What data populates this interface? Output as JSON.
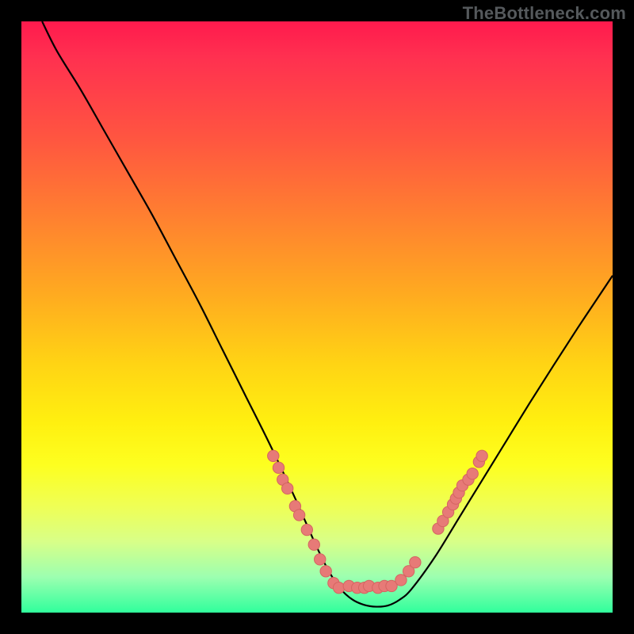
{
  "watermark": "TheBottleneck.com",
  "colors": {
    "curve_stroke": "#000000",
    "marker_fill": "#e77a77",
    "marker_stroke": "#d46561"
  },
  "chart_data": {
    "type": "line",
    "title": "",
    "xlabel": "",
    "ylabel": "",
    "xlim": [
      0,
      100
    ],
    "ylim": [
      0,
      100
    ],
    "curve": {
      "x": [
        3.5,
        6,
        10,
        14,
        18,
        22,
        26,
        30,
        34,
        38,
        42,
        46,
        48,
        50,
        52,
        54,
        56,
        58,
        60,
        62,
        64,
        66,
        70,
        74,
        78,
        82,
        86,
        90,
        94,
        98,
        100
      ],
      "y": [
        100,
        95,
        88.5,
        81.5,
        74.5,
        67.5,
        60,
        52.5,
        44.5,
        36.5,
        28.5,
        20,
        15.5,
        11,
        7,
        4,
        2.2,
        1.3,
        1.0,
        1.2,
        2.2,
        4,
        9.5,
        16,
        22.5,
        29,
        35.5,
        41.8,
        48,
        54,
        57
      ]
    },
    "markers": [
      {
        "x": 42.6,
        "y": 26.5
      },
      {
        "x": 43.5,
        "y": 24.5
      },
      {
        "x": 44.2,
        "y": 22.5
      },
      {
        "x": 45.0,
        "y": 21.0
      },
      {
        "x": 46.3,
        "y": 18.0
      },
      {
        "x": 47.0,
        "y": 16.5
      },
      {
        "x": 48.3,
        "y": 14.0
      },
      {
        "x": 49.5,
        "y": 11.5
      },
      {
        "x": 50.5,
        "y": 9.0
      },
      {
        "x": 51.5,
        "y": 7.0
      },
      {
        "x": 52.8,
        "y": 5.0
      },
      {
        "x": 53.7,
        "y": 4.2
      },
      {
        "x": 55.4,
        "y": 4.5
      },
      {
        "x": 56.8,
        "y": 4.2
      },
      {
        "x": 58.0,
        "y": 4.2
      },
      {
        "x": 58.8,
        "y": 4.5
      },
      {
        "x": 60.3,
        "y": 4.2
      },
      {
        "x": 61.4,
        "y": 4.5
      },
      {
        "x": 62.6,
        "y": 4.5
      },
      {
        "x": 64.2,
        "y": 5.5
      },
      {
        "x": 65.5,
        "y": 7.0
      },
      {
        "x": 66.6,
        "y": 8.5
      },
      {
        "x": 70.5,
        "y": 14.2
      },
      {
        "x": 71.3,
        "y": 15.5
      },
      {
        "x": 72.2,
        "y": 17.0
      },
      {
        "x": 73.0,
        "y": 18.3
      },
      {
        "x": 73.5,
        "y": 19.3
      },
      {
        "x": 74.0,
        "y": 20.3
      },
      {
        "x": 74.6,
        "y": 21.5
      },
      {
        "x": 75.6,
        "y": 22.5
      },
      {
        "x": 76.3,
        "y": 23.5
      },
      {
        "x": 77.4,
        "y": 25.5
      },
      {
        "x": 77.9,
        "y": 26.5
      }
    ]
  }
}
